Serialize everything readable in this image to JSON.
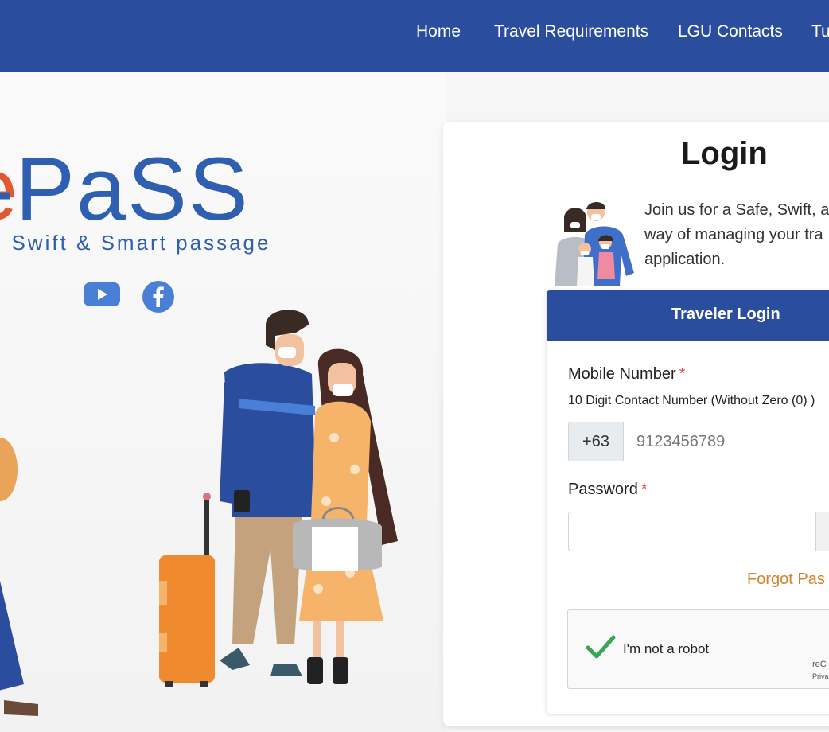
{
  "nav": {
    "items": [
      "Home",
      "Travel Requirements",
      "LGU Contacts",
      "Tu"
    ]
  },
  "hero": {
    "logo_e": "e",
    "logo_text": "-PaSS",
    "tagline": ", Swift & Smart passage",
    "social": [
      "youtube-icon",
      "facebook-icon"
    ]
  },
  "login": {
    "title": "Login",
    "intro_lines": [
      "Join us for a Safe, Swift, a",
      "way of managing your tra",
      "application."
    ],
    "tab_label": "Traveler Login",
    "mobile_label": "Mobile Number",
    "required_mark": "*",
    "mobile_helper": "10 Digit Contact Number (Without Zero (0) )",
    "prefix": "+63",
    "mobile_placeholder": "9123456789",
    "password_label": "Password",
    "password_value": "",
    "forgot_text": "Forgot Pas",
    "captcha_label": "I'm not a robot",
    "captcha_brand": "reC",
    "captcha_links": "Priva"
  },
  "colors": {
    "nav_bg": "#2a4d9e",
    "brand_blue": "#2f5fb0",
    "brand_orange": "#e2582f",
    "forgot_link": "#d4812a"
  }
}
